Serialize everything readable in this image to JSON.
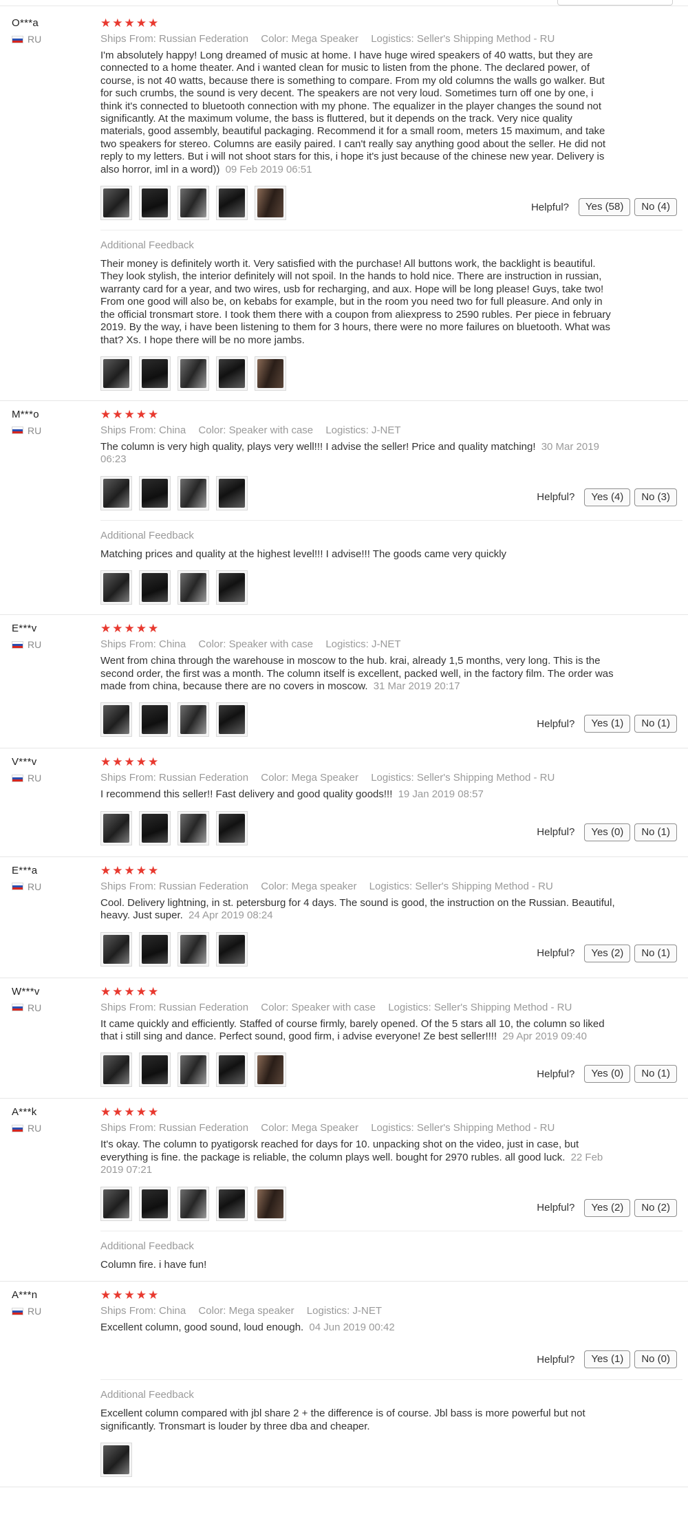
{
  "helpful_label": "Helpful?",
  "additional_label": "Additional Feedback",
  "colors": {
    "star": "#e8392f",
    "muted": "#9a9a9a"
  },
  "reviews": [
    {
      "user": "O***a",
      "country": "RU",
      "stars": "★★★★★",
      "ships_from": "Ships From: Russian Federation",
      "color": "Color: Mega Speaker",
      "logistics": "Logistics: Seller's Shipping Method - RU",
      "text": "I'm absolutely happy! Long dreamed of music at home. I have huge wired speakers of 40 watts, but they are connected to a home theater. And i wanted clean for music to listen from the phone. The declared power, of course, is not 40 watts, because there is something to compare. From my old columns the walls go walker. But for such crumbs, the sound is very decent. The speakers are not very loud. Sometimes turn off one by one, i think it's connected to bluetooth connection with my phone. The equalizer in the player changes the sound not significantly. At the maximum volume, the bass is fluttered, but it depends on the track. Very nice quality materials, good assembly, beautiful packaging. Recommend it for a small room, meters 15 maximum, and take two speakers for stereo. Columns are easily paired. I can't really say anything good about the seller. He did not reply to my letters. But i will not shoot stars for this, i hope it's just because of the chinese new year. Delivery is also horror, iml in a word))",
      "date": "09 Feb 2019 06:51",
      "photos": [
        "speaker-photo",
        "speaker-photo",
        "speaker-photo",
        "speaker-photo",
        "speaker-photo"
      ],
      "yes": "Yes (58)",
      "no": "No (4)",
      "additional": {
        "text": "Their money is definitely worth it. Very satisfied with the purchase! All buttons work, the backlight is beautiful. They look stylish, the interior definitely will not spoil. In the hands to hold nice. There are instruction in russian, warranty card for a year, and two wires, usb for recharging, and aux. Hope will be long please! Guys, take two! From one good will also be, on kebabs for example, but in the room you need two for full pleasure. And only in the official tronsmart store. I took them there with a coupon from aliexpress to 2590 rubles. Per piece in february 2019. By the way, i have been listening to them for 3 hours, there were no more failures on bluetooth. What was that? Xs. I hope there will be no more jambs.",
        "photos": [
          "speaker-photo",
          "speaker-photo",
          "speaker-photo",
          "speaker-photo",
          "speaker-photo"
        ]
      }
    },
    {
      "user": "M***o",
      "country": "RU",
      "stars": "★★★★★",
      "ships_from": "Ships From: China",
      "color": "Color: Speaker with case",
      "logistics": "Logistics: J-NET",
      "text": "The column is very high quality, plays very well!!! I advise the seller! Price and quality matching!",
      "date": "30 Mar 2019 06:23",
      "photos": [
        "speaker-photo",
        "speaker-photo",
        "speaker-photo",
        "speaker-photo"
      ],
      "yes": "Yes (4)",
      "no": "No (3)",
      "additional": {
        "text": "Matching prices and quality at the highest level!!! I advise!!! The goods came very quickly",
        "photos": [
          "speaker-photo",
          "speaker-photo",
          "speaker-photo",
          "speaker-photo"
        ]
      }
    },
    {
      "user": "E***v",
      "country": "RU",
      "stars": "★★★★★",
      "ships_from": "Ships From: China",
      "color": "Color: Speaker with case",
      "logistics": "Logistics: J-NET",
      "text": "Went from china through the warehouse in moscow to the hub. krai, already 1,5 months, very long. This is the second order, the first was a month. The column itself is excellent, packed well, in the factory film. The order was made from china, because there are no covers in moscow.",
      "date": "31 Mar 2019 20:17",
      "photos": [
        "speaker-photo",
        "speaker-photo",
        "speaker-photo",
        "speaker-photo"
      ],
      "yes": "Yes (1)",
      "no": "No (1)"
    },
    {
      "user": "V***v",
      "country": "RU",
      "stars": "★★★★★",
      "ships_from": "Ships From: Russian Federation",
      "color": "Color: Mega Speaker",
      "logistics": "Logistics: Seller's Shipping Method - RU",
      "text": "I recommend this seller!! Fast delivery and good quality goods!!!",
      "date": "19 Jan 2019 08:57",
      "photos": [
        "speaker-photo",
        "speaker-photo",
        "speaker-photo",
        "speaker-photo"
      ],
      "yes": "Yes (0)",
      "no": "No (1)"
    },
    {
      "user": "E***a",
      "country": "RU",
      "stars": "★★★★★",
      "ships_from": "Ships From: Russian Federation",
      "color": "Color: Mega speaker",
      "logistics": "Logistics: Seller's Shipping Method - RU",
      "text": "Cool. Delivery lightning, in st. petersburg for 4 days. The sound is good, the instruction on the Russian. Beautiful, heavy. Just super.",
      "date": "24 Apr 2019 08:24",
      "photos": [
        "speaker-photo",
        "speaker-photo",
        "speaker-photo",
        "speaker-photo"
      ],
      "yes": "Yes (2)",
      "no": "No (1)"
    },
    {
      "user": "W***v",
      "country": "RU",
      "stars": "★★★★★",
      "ships_from": "Ships From: Russian Federation",
      "color": "Color: Speaker with case",
      "logistics": "Logistics: Seller's Shipping Method - RU",
      "text": "It came quickly and efficiently. Staffed of course firmly, barely opened. Of the 5 stars all 10, the column so liked that i still sing and dance. Perfect sound, good firm, i advise everyone! Ze best seller!!!!",
      "date": "29 Apr 2019 09:40",
      "photos": [
        "speaker-photo",
        "speaker-photo",
        "speaker-photo",
        "speaker-photo",
        "speaker-photo"
      ],
      "yes": "Yes (0)",
      "no": "No (1)"
    },
    {
      "user": "A***k",
      "country": "RU",
      "stars": "★★★★★",
      "ships_from": "Ships From: Russian Federation",
      "color": "Color: Mega Speaker",
      "logistics": "Logistics: Seller's Shipping Method - RU",
      "text": "It's okay. The column to pyatigorsk reached for days for 10. unpacking shot on the video, just in case, but everything is fine. the package is reliable, the column plays well. bought for 2970 rubles. all good luck.",
      "date": "22 Feb 2019 07:21",
      "photos": [
        "speaker-photo",
        "speaker-photo",
        "speaker-photo",
        "speaker-photo",
        "speaker-photo"
      ],
      "yes": "Yes (2)",
      "no": "No (2)",
      "additional": {
        "text": "Column fire. i have fun!",
        "photos": []
      }
    },
    {
      "user": "A***n",
      "country": "RU",
      "stars": "★★★★★",
      "ships_from": "Ships From: China",
      "color": "Color: Mega speaker",
      "logistics": "Logistics: J-NET",
      "text": "Excellent column, good sound, loud enough.",
      "date": "04 Jun 2019 00:42",
      "photos": [],
      "yes": "Yes (1)",
      "no": "No (0)",
      "additional": {
        "text": "Excellent column compared with jbl share 2 + the difference is of course. Jbl bass is more powerful but not significantly. Tronsmart is louder by three dba and cheaper.",
        "photos": [
          "speaker-photo"
        ]
      }
    }
  ]
}
